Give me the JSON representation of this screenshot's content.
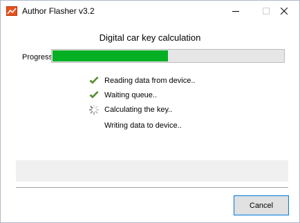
{
  "window": {
    "title": "Author Flasher v3.2",
    "controls": [
      "minimize",
      "maximize",
      "close"
    ]
  },
  "dialog": {
    "heading": "Digital car key calculation",
    "progress": {
      "label": "Progress:",
      "fraction": 0.5
    },
    "steps": [
      {
        "label": "Reading data from device..",
        "state": "done",
        "icon": "check-icon"
      },
      {
        "label": "Waiting queue..",
        "state": "done",
        "icon": "check-icon"
      },
      {
        "label": "Calculating the key..",
        "state": "in-progress",
        "icon": "spinner-icon"
      },
      {
        "label": "Writing data to device..",
        "state": "pending",
        "icon": ""
      }
    ],
    "status_text": "",
    "cancel_label": "Cancel"
  },
  "colors": {
    "progress_fill": "#06b025",
    "progress_track": "#e6e6e6",
    "check": "#5e9c2d",
    "button_focus_border": "#0078d7"
  }
}
